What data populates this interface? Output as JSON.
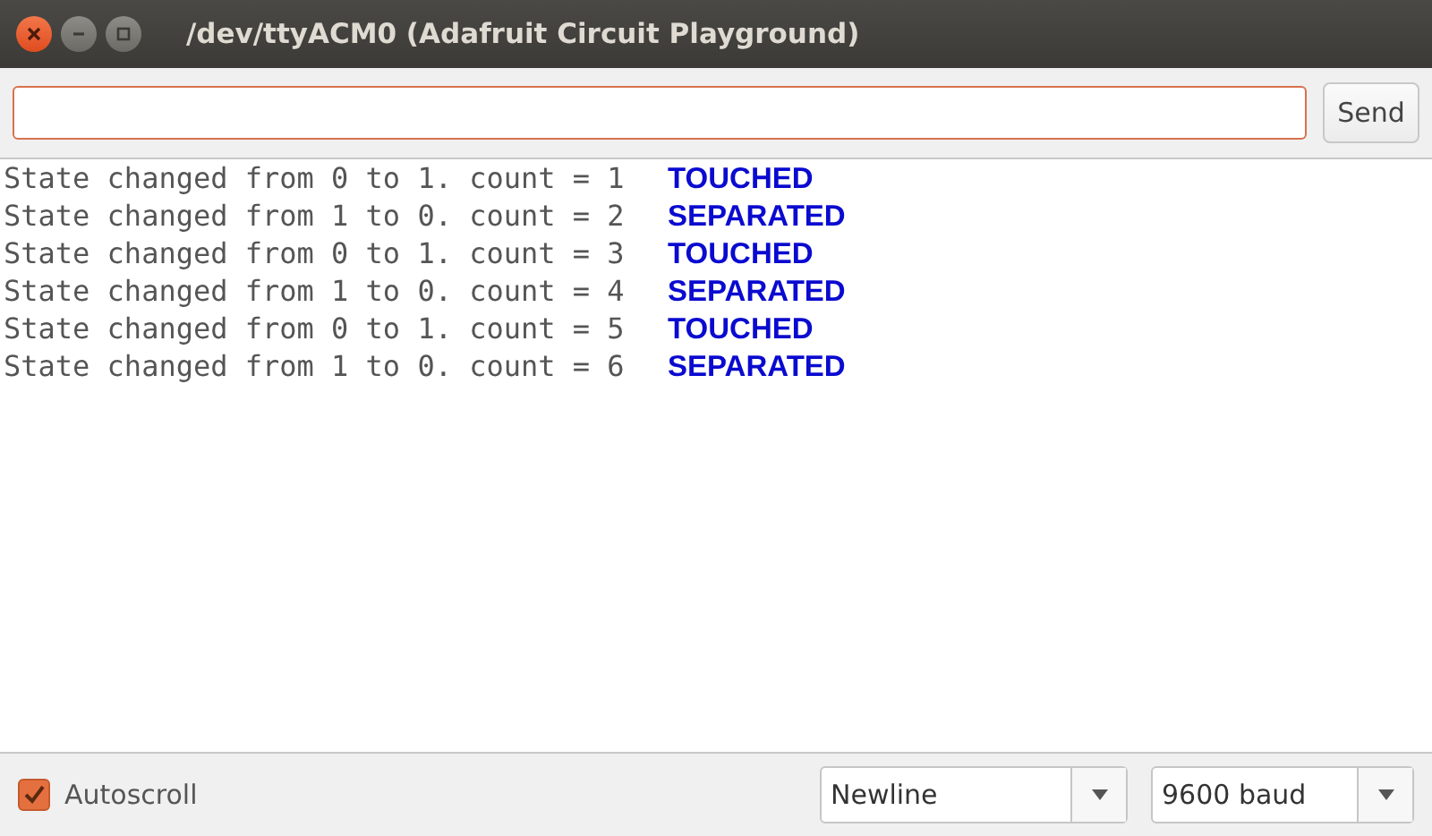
{
  "window": {
    "title": "/dev/ttyACM0 (Adafruit Circuit Playground)"
  },
  "send_button": "Send",
  "output": [
    {
      "text": "State changed from 0 to 1. count = 1",
      "tag": "TOUCHED"
    },
    {
      "text": "State changed from 1 to 0. count = 2",
      "tag": "SEPARATED"
    },
    {
      "text": "State changed from 0 to 1. count = 3",
      "tag": "TOUCHED"
    },
    {
      "text": "State changed from 1 to 0. count = 4",
      "tag": "SEPARATED"
    },
    {
      "text": "State changed from 0 to 1. count = 5",
      "tag": "TOUCHED"
    },
    {
      "text": "State changed from 1 to 0. count = 6",
      "tag": "SEPARATED"
    }
  ],
  "autoscroll": {
    "label": "Autoscroll",
    "checked": true
  },
  "line_ending": {
    "value": "Newline"
  },
  "baud_rate": {
    "value": "9600 baud"
  }
}
